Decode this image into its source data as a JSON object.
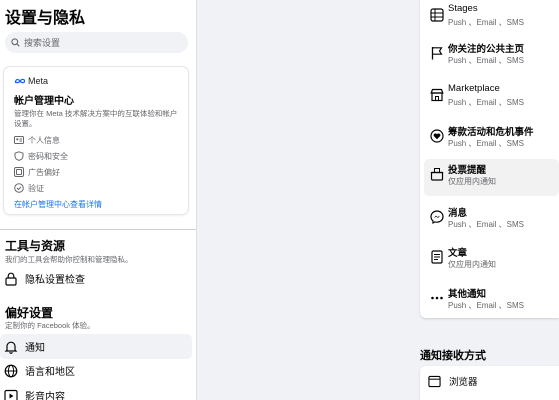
{
  "sidebar": {
    "title": "设置与隐私",
    "search_placeholder": "搜索设置",
    "meta_card": {
      "logo_text": "Meta",
      "title": "帐户管理中心",
      "description": "管理你在 Meta 技术解决方案中的互联体验和帐户设置。",
      "items": [
        {
          "icon": "person-card-icon",
          "label": "个人信息"
        },
        {
          "icon": "shield-icon",
          "label": "密码和安全"
        },
        {
          "icon": "ad-monitor-icon",
          "label": "广告偏好"
        },
        {
          "icon": "check-circle-icon",
          "label": "验证"
        }
      ],
      "link": "在帐户管理中心查看详情"
    },
    "tools": {
      "title": "工具与资源",
      "subtitle": "我们的工具会帮助你控制和管理隐私。",
      "items": [
        {
          "icon": "lock-icon",
          "label": "隐私设置检查"
        }
      ]
    },
    "prefs": {
      "title": "偏好设置",
      "subtitle": "定制你的 Facebook 体验。",
      "items": [
        {
          "icon": "bell-icon",
          "label": "通知",
          "active": true
        },
        {
          "icon": "globe-icon",
          "label": "语言和地区"
        },
        {
          "icon": "video-icon",
          "label": "影音内容"
        }
      ]
    }
  },
  "notifications": {
    "items": [
      {
        "icon": "stages-icon",
        "title": "Stages",
        "sub": "Push 、Email 、SMS"
      },
      {
        "icon": "flag-icon",
        "title": "你关注的公共主页",
        "sub": "Push 、Email 、SMS"
      },
      {
        "icon": "shop-icon",
        "title": "Marketplace",
        "sub": "Push 、Email 、SMS"
      },
      {
        "icon": "fundraiser-icon",
        "title": "筹款活动和危机事件",
        "sub": "Push 、Email 、SMS"
      },
      {
        "icon": "ballot-box-icon",
        "title": "投票提醒",
        "sub": "仅应用内通知"
      },
      {
        "icon": "messenger-icon",
        "title": "消息",
        "sub": "Push 、Email 、SMS"
      },
      {
        "icon": "article-icon",
        "title": "文章",
        "sub": "仅应用内通知"
      },
      {
        "icon": "more-dots-icon",
        "title": "其他通知",
        "sub": "Push 、Email 、SMS"
      }
    ],
    "receive_title": "通知接收方式",
    "browser_label": "浏览器"
  },
  "colors": {
    "link": "#1877f2",
    "background": "#f0f2f5",
    "secondary_text": "#65676b"
  }
}
